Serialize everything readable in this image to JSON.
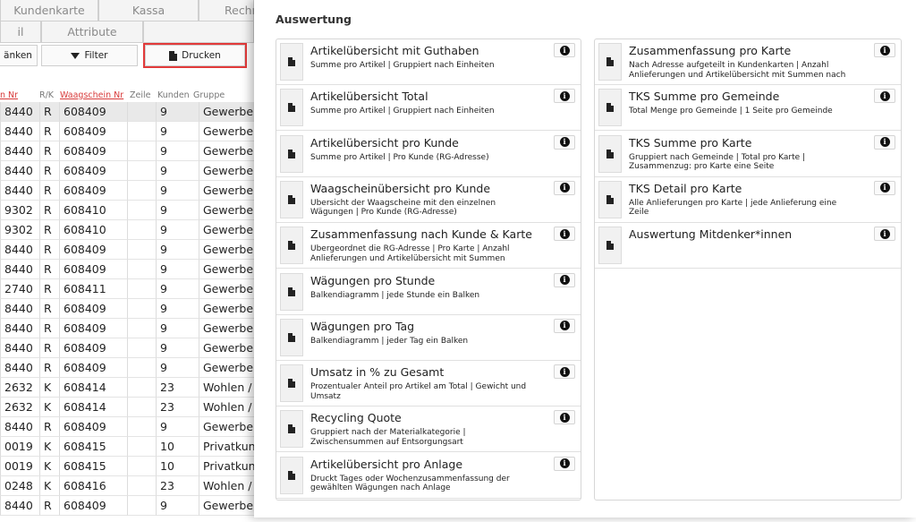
{
  "background": {
    "tabs_row1": [
      "Kundenkarte",
      "Kassa",
      "Rechn"
    ],
    "tabs_row2": [
      "il",
      "Attribute",
      ""
    ],
    "toolbar": {
      "cut_label": "änken",
      "filter_label": "Filter",
      "print_label": "Drucken"
    },
    "columns": {
      "nr": "n Nr",
      "rk": "R/K",
      "waagschein": "Waagschein Nr",
      "zeile": "Zeile",
      "kunden": "Kunden",
      "gruppe": "Gruppe"
    },
    "rows": [
      [
        "8440",
        "R",
        "608409",
        "",
        "9",
        "Gewerbe"
      ],
      [
        "8440",
        "R",
        "608409",
        "",
        "9",
        "Gewerbe"
      ],
      [
        "8440",
        "R",
        "608409",
        "",
        "9",
        "Gewerbe"
      ],
      [
        "8440",
        "R",
        "608409",
        "",
        "9",
        "Gewerbe"
      ],
      [
        "8440",
        "R",
        "608409",
        "",
        "9",
        "Gewerbe"
      ],
      [
        "9302",
        "R",
        "608410",
        "",
        "9",
        "Gewerbe"
      ],
      [
        "9302",
        "R",
        "608410",
        "",
        "9",
        "Gewerbe"
      ],
      [
        "8440",
        "R",
        "608409",
        "",
        "9",
        "Gewerbe"
      ],
      [
        "8440",
        "R",
        "608409",
        "",
        "9",
        "Gewerbe"
      ],
      [
        "2740",
        "R",
        "608411",
        "",
        "9",
        "Gewerbe"
      ],
      [
        "8440",
        "R",
        "608409",
        "",
        "9",
        "Gewerbe"
      ],
      [
        "8440",
        "R",
        "608409",
        "",
        "9",
        "Gewerbe"
      ],
      [
        "8440",
        "R",
        "608409",
        "",
        "9",
        "Gewerbe"
      ],
      [
        "8440",
        "R",
        "608409",
        "",
        "9",
        "Gewerbe"
      ],
      [
        "2632",
        "K",
        "608414",
        "",
        "23",
        "Wohlen / ."
      ],
      [
        "2632",
        "K",
        "608414",
        "",
        "23",
        "Wohlen / ."
      ],
      [
        "8440",
        "R",
        "608409",
        "",
        "9",
        "Gewerbe"
      ],
      [
        "0019",
        "K",
        "608415",
        "",
        "10",
        "Privatkunc"
      ],
      [
        "0019",
        "K",
        "608415",
        "",
        "10",
        "Privatkunc"
      ],
      [
        "0248",
        "K",
        "608416",
        "",
        "23",
        "Wohlen / ."
      ],
      [
        "8440",
        "R",
        "608409",
        "",
        "9",
        "Gewerbe"
      ]
    ]
  },
  "modal": {
    "title": "Auswertung",
    "info_glyph": "i",
    "left_items": [
      {
        "title": "Artikelübersicht mit Guthaben",
        "desc": "Summe pro Artikel | Gruppiert nach Einheiten"
      },
      {
        "title": "Artikelübersicht Total",
        "desc": "Summe pro Artikel | Gruppiert nach Einheiten"
      },
      {
        "title": "Artikelübersicht pro Kunde",
        "desc": "Summe pro Artikel | Pro Kunde (RG-Adresse)"
      },
      {
        "title": "Waagscheinübersicht pro Kunde",
        "desc": "Übersicht der Waagscheine mit den einzelnen Wägungen | Pro Kunde (RG-Adresse)"
      },
      {
        "title": "Zusammenfassung nach Kunde & Karte",
        "desc": "Übergeordnet die RG-Adresse | Pro Karte | Anzahl Anlieferungen und Artikelübersicht mit Summen"
      },
      {
        "title": "Wägungen pro Stunde",
        "desc": "Balkendiagramm | jede Stunde ein Balken"
      },
      {
        "title": "Wägungen pro Tag",
        "desc": "Balkendiagramm | jeder Tag ein Balken"
      },
      {
        "title": "Umsatz in % zu Gesamt",
        "desc": "Prozentualer Anteil pro Artikel am Total | Gewicht und Umsatz"
      },
      {
        "title": "Recycling Quote",
        "desc": "Gruppiert nach der Materialkategorie | Zwischensummen auf Entsorgungsart"
      },
      {
        "title": "Artikelübersicht pro Anlage",
        "desc": "Druckt Tages oder Wochenzusammenfassung der gewählten Wägungen nach Anlage"
      }
    ],
    "right_items": [
      {
        "title": "Zusammenfassung pro Karte",
        "desc": "Nach Adresse aufgeteilt in Kundenkarten | Anzahl Anlieferungen und Artikelübersicht mit Summen nach"
      },
      {
        "title": "TKS Summe pro Gemeinde",
        "desc": "Total Menge pro Gemeinde | 1 Seite pro Gemeinde"
      },
      {
        "title": "TKS Summe pro Karte",
        "desc": "Gruppiert nach Gemeinde | Total pro Karte | Zusammenzug: pro Karte eine Seite"
      },
      {
        "title": "TKS Detail pro Karte",
        "desc": "Alle Anlieferungen pro Karte | jede Anlieferung eine Zeile"
      },
      {
        "title": "Auswertung Mitdenker*innen",
        "desc": ""
      }
    ]
  }
}
